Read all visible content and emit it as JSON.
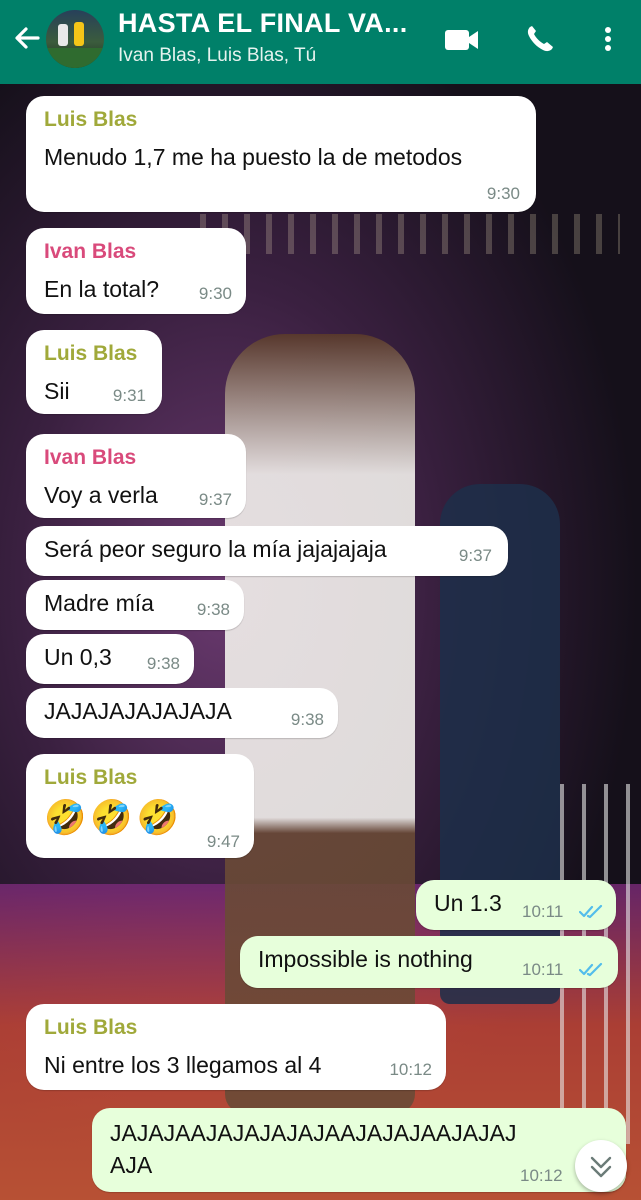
{
  "header": {
    "title": "HASTA EL FINAL VA...",
    "subtitle": "Ivan Blas, Luis Blas, Tú",
    "back_icon": "arrow-left-icon",
    "video_icon": "video-camera-icon",
    "call_icon": "phone-icon",
    "menu_icon": "more-vertical-icon",
    "bg_color": "#008069"
  },
  "messages": [
    {
      "sender": "Luis Blas",
      "text": "Menudo 1,7 me ha puesto la de metodos",
      "time": "9:30"
    },
    {
      "sender": "Ivan Blas",
      "text": "En la total?",
      "time": "9:30"
    },
    {
      "sender": "Luis Blas",
      "text": "Sii",
      "time": "9:31"
    },
    {
      "sender": "Ivan Blas",
      "text": "Voy a verla",
      "time": "9:37"
    },
    {
      "sender": "",
      "text": "Será peor seguro la mía jajajajaja",
      "time": "9:37"
    },
    {
      "sender": "",
      "text": "Madre mía",
      "time": "9:38"
    },
    {
      "sender": "",
      "text": "Un 0,3",
      "time": "9:38"
    },
    {
      "sender": "",
      "text": "JAJAJAJAJAJAJA",
      "time": "9:38"
    },
    {
      "sender": "Luis Blas",
      "text": "🤣🤣🤣",
      "time": "9:47"
    },
    {
      "sender": "Tú",
      "text": "Un 1.3",
      "time": "10:11",
      "status": "read"
    },
    {
      "sender": "Tú",
      "text": "Impossible is nothing",
      "time": "10:11",
      "status": "read"
    },
    {
      "sender": "Luis Blas",
      "text": "Ni entre los 3 llegamos al 4",
      "time": "10:12"
    },
    {
      "sender": "Tú",
      "text_line1": "JAJAJAAJAJAJAJAJAAJAJAJAAJAJAJ",
      "text_line2": "AJA",
      "time": "10:12"
    }
  ],
  "scroll_down_icon": "double-chevron-down-icon",
  "colors": {
    "incoming_bubble": "#ffffff",
    "outgoing_bubble": "#e7ffdb",
    "luis_name": "#a0a93a",
    "ivan_name": "#d94a7b",
    "read_ticks": "#53bdeb"
  }
}
